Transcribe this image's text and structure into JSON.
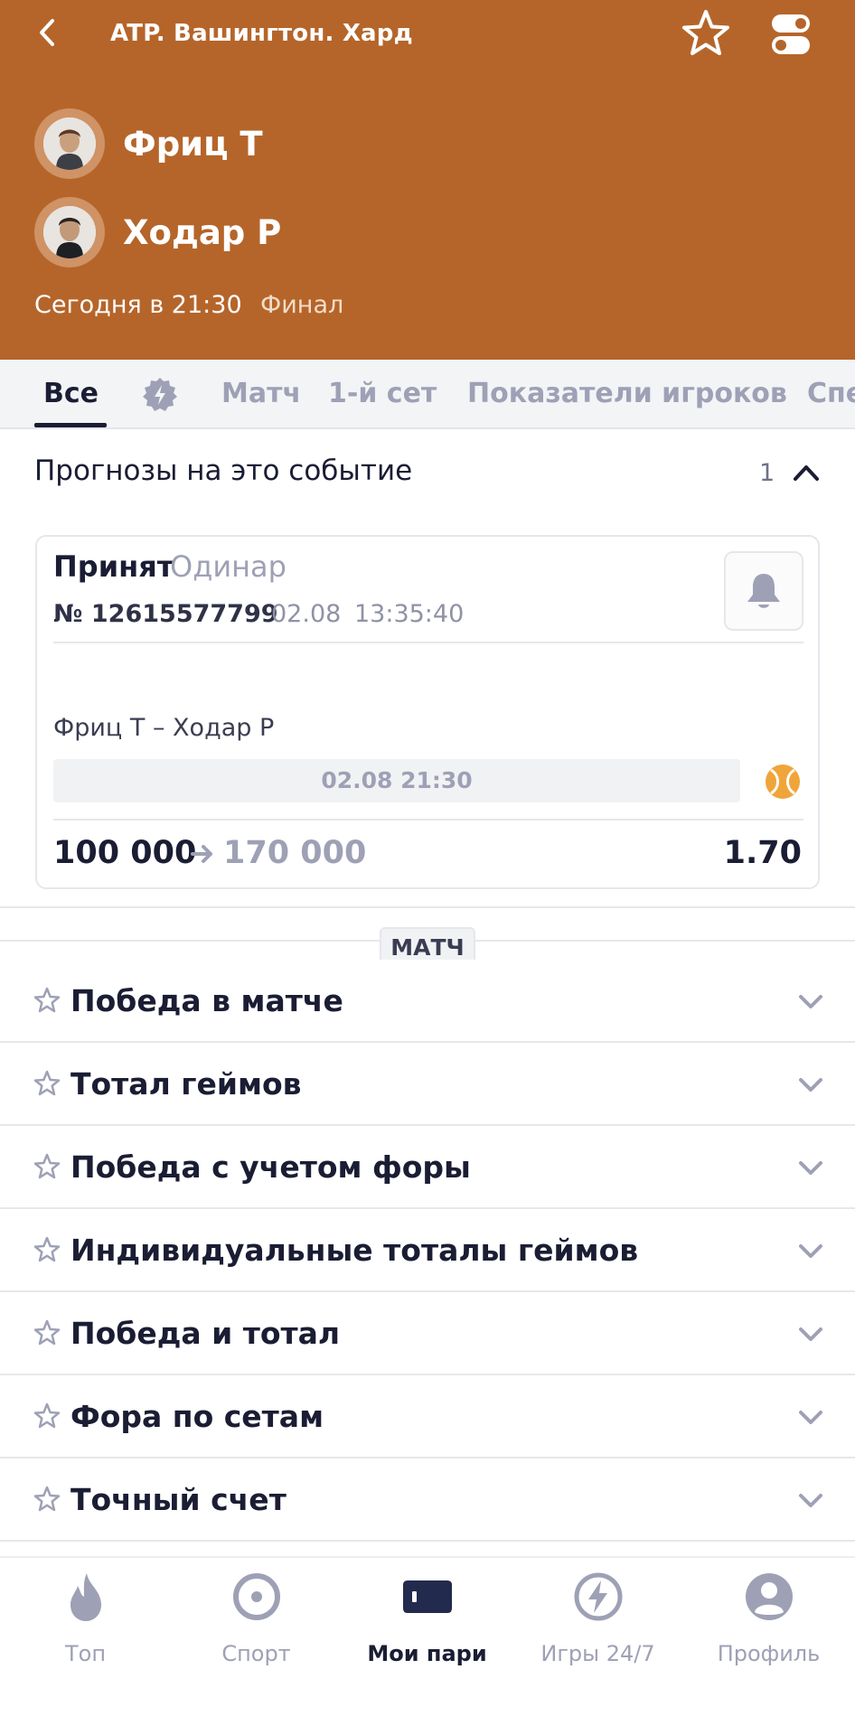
{
  "header": {
    "title": "ATP. Вашингтон. Хард",
    "player1": "Фриц Т",
    "player2": "Ходар Р",
    "match_time": "Сегодня в 21:30",
    "stage": "Финал",
    "background_color": "#b5652a"
  },
  "tabs": {
    "items": [
      "Все",
      "Матч",
      "1-й сет",
      "Показатели игроков",
      "Спе"
    ],
    "active": "Все",
    "special_icon": "lightning-badge-icon"
  },
  "predictions": {
    "title": "Прогнозы на это событие",
    "count": "1",
    "bet": {
      "status": "Принят",
      "type": "Одинар",
      "number": "№ 12615577799",
      "date": "02.08",
      "time": "13:35:40",
      "event": "Фриц Т – Ходар Р",
      "event_datetime": "02.08 21:30",
      "stake": "100 000",
      "payout": "170 000",
      "odds": "1.70"
    }
  },
  "markets": {
    "section_label": "МАТЧ",
    "items": [
      "Победа в матче",
      "Тотал геймов",
      "Победа с учетом форы",
      "Индивидуальные тоталы геймов",
      "Победа и тотал",
      "Фора по сетам",
      "Точный счет"
    ]
  },
  "bottom_nav": {
    "items": [
      {
        "label": "Топ",
        "icon": "flame-icon"
      },
      {
        "label": "Спорт",
        "icon": "sport-target-icon"
      },
      {
        "label": "Мои пари",
        "icon": "ticket-icon"
      },
      {
        "label": "Игры 24/7",
        "icon": "lightning-icon"
      },
      {
        "label": "Профиль",
        "icon": "profile-icon"
      }
    ],
    "active": "Мои пари"
  }
}
